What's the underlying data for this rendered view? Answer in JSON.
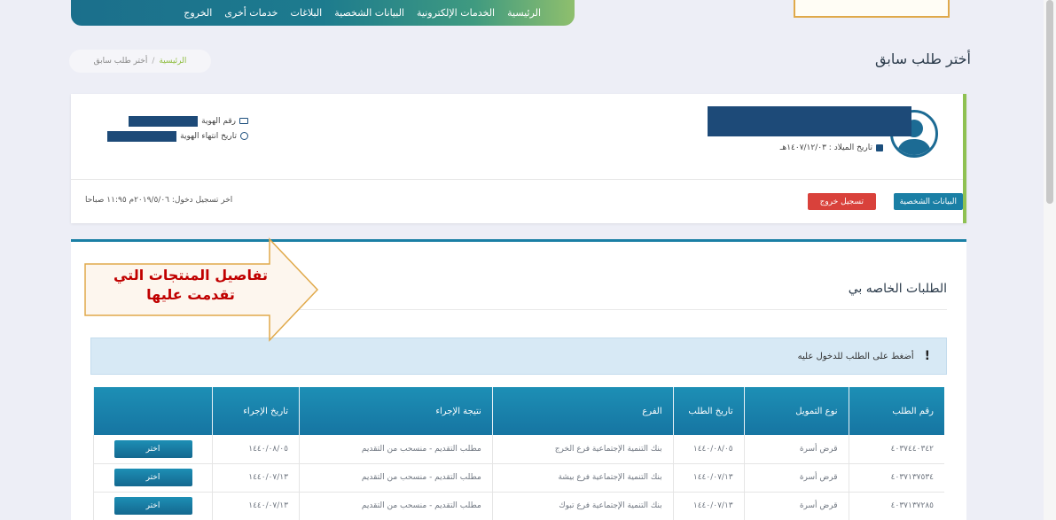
{
  "nav": {
    "items": [
      "الرئيسية",
      "الخدمات الإلكترونية",
      "البيانات الشخصية",
      "البلاغات",
      "خدمات أخرى",
      "الخروج"
    ]
  },
  "page": {
    "title": "أختر طلب سابق",
    "breadcrumb": {
      "home": "الرئيسية",
      "separator": "/",
      "current": "أختر طلب سابق"
    }
  },
  "profile": {
    "dob_label": "تاريخ الميلاد : ١٤٠٧/١٢/٠٣هـ",
    "id_label": "رقم الهوية",
    "id_expiry_label": "تاريخ انتهاء الهوية",
    "last_login": "اخر تسجيل دخول: ٢٠١٩/٥/٠٦م ١١:٩٥ صباحا",
    "personal_data_button": "البيانات الشخصية",
    "logout_button": "تسجيل خروج"
  },
  "requests": {
    "title": "الطلبات الخاصه بي",
    "alert": "أضغط على الطلب للدخول عليه",
    "columns": [
      "رقم الطلب",
      "نوع التمويل",
      "تاريخ الطلب",
      "الفرع",
      "نتيجة الإجراء",
      "تاريخ الإجراء",
      ""
    ],
    "rows": [
      {
        "id": "٤٠٣٧٤٤٠٣٤٢",
        "type": "قرض أسرة",
        "date": "١٤٤٠/٠٨/٠٥",
        "branch": "بنك التنمية الإجتماعية فرع الخرج",
        "result": "مطلب التقديم - منسحب من التقديم",
        "action_date": "١٤٤٠/٠٨/٠٥",
        "button": "اختر"
      },
      {
        "id": "٤٠٣٧١٣٧٥٣٤",
        "type": "قرض أسرة",
        "date": "١٤٤٠/٠٧/١٣",
        "branch": "بنك التنمية الإجتماعية فرع بيشة",
        "result": "مطلب التقديم - منسحب من التقديم",
        "action_date": "١٤٤٠/٠٧/١٣",
        "button": "اختر"
      },
      {
        "id": "٤٠٣٧١٣٧٢٨٥",
        "type": "قرض أسرة",
        "date": "١٤٤٠/٠٧/١٣",
        "branch": "بنك التنمية الإجتماعية فرع تبوك",
        "result": "مطلب التقديم - منسحب من التقديم",
        "action_date": "١٤٤٠/٠٧/١٣",
        "button": "اختر"
      }
    ]
  },
  "annotation": {
    "text": "تفاصيل المنتجات التي تقدمت عليها"
  },
  "colors": {
    "primary": "#1a7fa5",
    "accent_green": "#8fc152",
    "danger": "#d9413b",
    "annotation_red": "#c00000",
    "annotation_border": "#e0a94a"
  }
}
